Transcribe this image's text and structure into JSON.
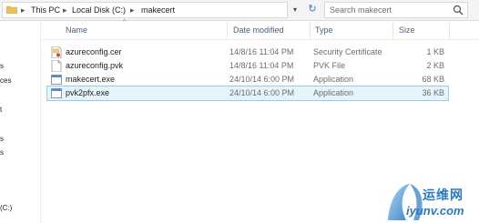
{
  "address_bar": {
    "crumbs": [
      "This PC",
      "Local Disk (C:)",
      "makecert"
    ],
    "separator": "▸",
    "dropdown_glyph": "▾",
    "refresh_glyph": "↻"
  },
  "search": {
    "placeholder": "Search makecert"
  },
  "nav_pane": {
    "fragments": [
      "s",
      "ces",
      "t",
      "s",
      "s"
    ],
    "drive": "(C:)"
  },
  "columns": {
    "name": "Name",
    "date": "Date modified",
    "type": "Type",
    "size": "Size",
    "sort_glyph": "^"
  },
  "files": [
    {
      "name": "azureconfig.cer",
      "date": "14/8/16 11:04 PM",
      "type": "Security Certificate",
      "size": "1 KB",
      "icon": "certificate-icon",
      "selected": false
    },
    {
      "name": "azureconfig.pvk",
      "date": "14/8/16 11:04 PM",
      "type": "PVK File",
      "size": "2 KB",
      "icon": "file-icon",
      "selected": false
    },
    {
      "name": "makecert.exe",
      "date": "24/10/14 6:00 PM",
      "type": "Application",
      "size": "68 KB",
      "icon": "application-icon",
      "selected": false
    },
    {
      "name": "pvk2pfx.exe",
      "date": "24/10/14 6:00 PM",
      "type": "Application",
      "size": "36 KB",
      "icon": "application-icon",
      "selected": true
    }
  ],
  "watermark": {
    "text_cn": "运维网",
    "url": "iyunv.com"
  },
  "colors": {
    "accent": "#2a79c4",
    "selection": "#e5f3fb",
    "header_text": "#4c607a"
  }
}
